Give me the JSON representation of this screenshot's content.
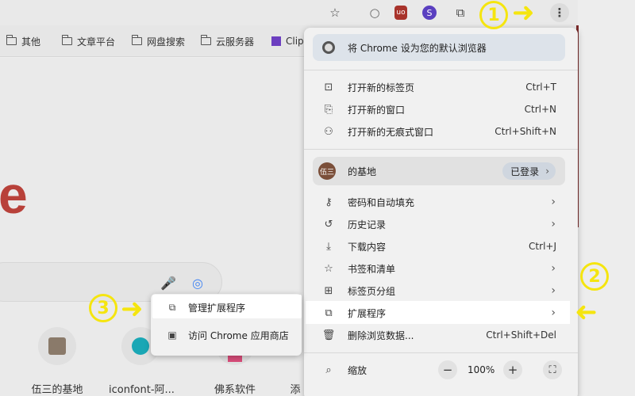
{
  "toolbar": {
    "star_icon": "☆",
    "ext_icons": [
      "○",
      "uo",
      "S",
      "⧉"
    ],
    "kebab_icon": "⋮"
  },
  "bookmarks": [
    "其他",
    "文章平台",
    "网盘搜索",
    "云服务器",
    "Clip"
  ],
  "page": {
    "logo_fragment": "e",
    "shortcuts": [
      "伍三的基地",
      "iconfont-阿...",
      "佛系软件",
      "添"
    ]
  },
  "menu": {
    "default_browser": "将 Chrome 设为您的默认浏览器",
    "group1": [
      {
        "label": "打开新的标签页",
        "shortcut": "Ctrl+T",
        "icon": "⊡"
      },
      {
        "label": "打开新的窗口",
        "shortcut": "Ctrl+N",
        "icon": "⎘"
      },
      {
        "label": "打开新的无痕式窗口",
        "shortcut": "Ctrl+Shift+N",
        "icon": "⚇"
      }
    ],
    "profile": {
      "avatar": "伍三",
      "name": "的基地",
      "status": "已登录"
    },
    "group2": [
      {
        "label": "密码和自动填充",
        "icon": "⚷"
      },
      {
        "label": "历史记录",
        "icon": "↺"
      },
      {
        "label": "下载内容",
        "shortcut": "Ctrl+J",
        "icon": "⤓"
      },
      {
        "label": "书签和清单",
        "icon": "☆"
      },
      {
        "label": "标签页分组",
        "icon": "⊞"
      },
      {
        "label": "扩展程序",
        "icon": "⧉"
      },
      {
        "label": "删除浏览数据...",
        "shortcut": "Ctrl+Shift+Del",
        "icon": "🗑"
      }
    ],
    "zoom": {
      "label": "缩放",
      "value": "100%",
      "minus": "−",
      "plus": "+",
      "fullscreen": "⛶"
    }
  },
  "submenu": {
    "items": [
      "管理扩展程序",
      "访问 Chrome 应用商店"
    ]
  },
  "annotations": {
    "n1": "1",
    "n2": "2",
    "n3": "3",
    "accent": "#f5e50f"
  }
}
